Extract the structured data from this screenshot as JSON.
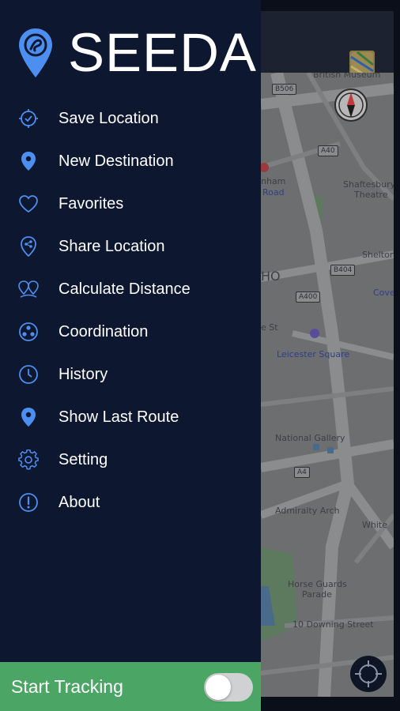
{
  "app": {
    "name": "SEEDA",
    "accent_color": "#4d8ff0",
    "drawer_bg": "#0e1730"
  },
  "menu": {
    "items": [
      {
        "label": "Save Location",
        "icon": "crosshair-check-icon"
      },
      {
        "label": "New Destination",
        "icon": "location-pin-icon"
      },
      {
        "label": "Favorites",
        "icon": "heart-icon"
      },
      {
        "label": "Share Location",
        "icon": "share-pin-icon"
      },
      {
        "label": "Calculate Distance",
        "icon": "distance-pins-icon"
      },
      {
        "label": "Coordination",
        "icon": "coordination-icon"
      },
      {
        "label": "History",
        "icon": "clock-icon"
      },
      {
        "label": "Show Last Route",
        "icon": "route-pin-icon"
      },
      {
        "label": "Setting",
        "icon": "gear-icon"
      },
      {
        "label": "About",
        "icon": "info-icon"
      }
    ]
  },
  "tracking": {
    "label": "Start Tracking",
    "enabled": false,
    "bar_color": "#4ba564"
  },
  "map": {
    "labels": [
      "British Museum",
      "nham",
      "Road",
      "Shaftesbury",
      "Theatre",
      "HO",
      "e St",
      "Shelton",
      "Cove",
      "Leicester Square",
      "National Gallery",
      "Admiralty Arch",
      "White",
      "Horse Guards",
      "Parade",
      "10 Downing Street"
    ],
    "road_shields": [
      "B506",
      "A40",
      "B404",
      "A400",
      "A4"
    ]
  }
}
